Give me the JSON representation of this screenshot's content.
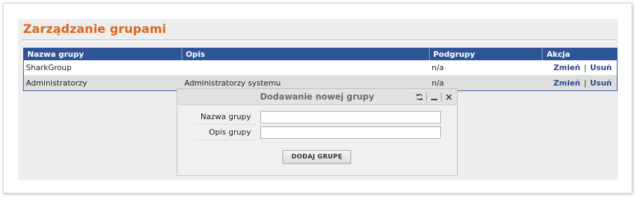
{
  "page": {
    "title": "Zarządzanie grupami"
  },
  "table": {
    "columns": [
      "Nazwa grupy",
      "Opis",
      "Podgrupy",
      "Akcja"
    ],
    "rows": [
      {
        "name": "SharkGroup",
        "description": "",
        "subgroups": "n/a",
        "edit_label": "Zmień",
        "delete_label": "Usuń"
      },
      {
        "name": "Administratorzy",
        "description": "Administratorzy systemu",
        "subgroups": "n/a",
        "edit_label": "Zmień",
        "delete_label": "Usuń"
      }
    ],
    "action_separator": "|"
  },
  "dialog": {
    "title": "Dodawanie nowej grupy",
    "controls": [
      "refresh-icon",
      "minimize-icon",
      "close-icon"
    ],
    "fields": [
      {
        "label": "Nazwa grupy",
        "value": ""
      },
      {
        "label": "Opis grupy",
        "value": ""
      }
    ],
    "submit_label": "DODAJ GRUPĘ"
  },
  "colors": {
    "title_orange": "#e0661a",
    "header_blue": "#2e5597",
    "link_blue": "#2e4a8a",
    "alt_row_gray": "#dedede"
  }
}
